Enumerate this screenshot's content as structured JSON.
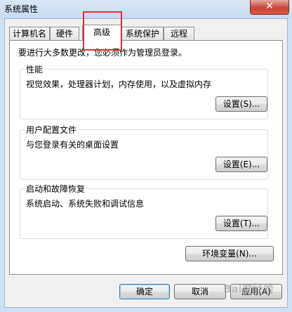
{
  "window": {
    "title": "系统属性",
    "close_glyph": "✕"
  },
  "tabs": [
    {
      "label": "计算机名"
    },
    {
      "label": "硬件"
    },
    {
      "label": "高级",
      "active": true
    },
    {
      "label": "系统保护"
    },
    {
      "label": "远程"
    }
  ],
  "notice": "要进行大多数更改，您必须作为管理员登录。",
  "groups": {
    "performance": {
      "title": "性能",
      "desc": "视觉效果，处理器计划，内存使用，以及虚拟内存",
      "button": "设置(S)..."
    },
    "user_profiles": {
      "title": "用户配置文件",
      "desc": "与您登录有关的桌面设置",
      "button": "设置(E)..."
    },
    "startup_recovery": {
      "title": "启动和故障恢复",
      "desc": "系统启动、系统失败和调试信息",
      "button": "设置(T)..."
    }
  },
  "env_button": "环境变量(N)...",
  "footer": {
    "ok": "确定",
    "cancel": "取消",
    "apply": "应用(A)"
  },
  "watermark": "Bai度经验",
  "colors": {
    "highlight": "#e03030",
    "close_button": "#c7453b"
  }
}
